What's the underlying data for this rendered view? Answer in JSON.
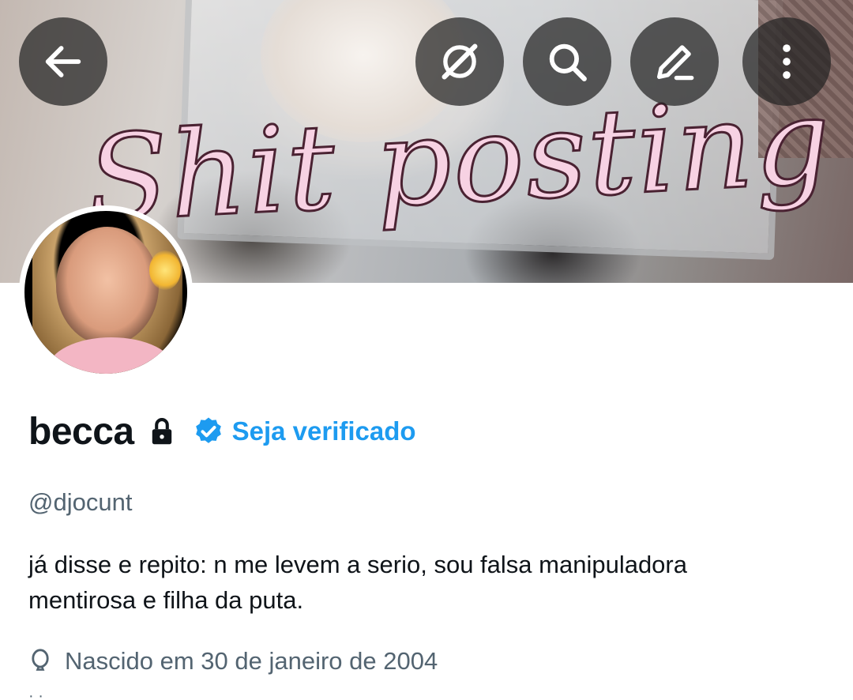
{
  "header": {
    "banner_text": "Shit posting",
    "buttons": {
      "back": "back-arrow-icon",
      "grok": "grok-icon",
      "search": "search-icon",
      "edit": "edit-icon",
      "more": "more-vertical-icon"
    }
  },
  "profile": {
    "display_name": "becca",
    "verify_cta": "Seja verificado",
    "handle": "@djocunt",
    "bio_line1": "já disse e repito: n me levem a serio, sou falsa manipuladora",
    "bio_line2": "mentirosa e filha da puta.",
    "birth_text": "Nascido em 30 de janeiro de 2004"
  },
  "colors": {
    "accent": "#1d9bf0",
    "text_primary": "#0f1419",
    "text_secondary": "#536471",
    "button_overlay": "#222222"
  }
}
